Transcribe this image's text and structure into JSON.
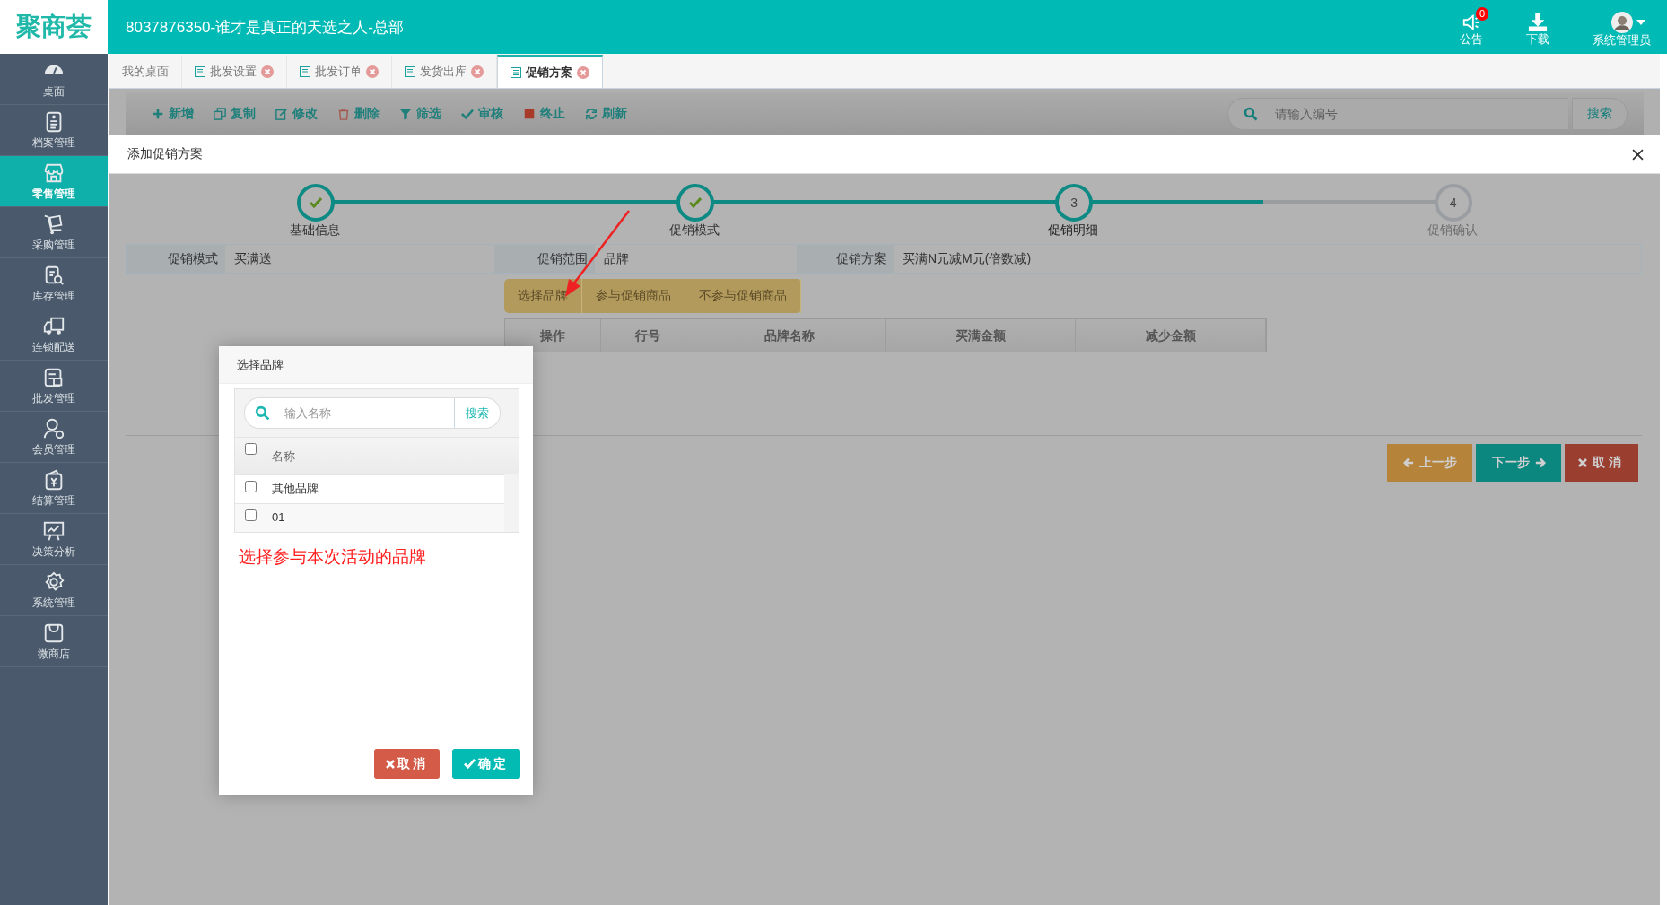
{
  "app": {
    "logo": "聚商荟",
    "title": "8037876350-谁才是真正的天选之人-总部"
  },
  "header_actions": [
    {
      "kind": "notice",
      "label": "公告",
      "badge": "0"
    },
    {
      "kind": "download",
      "label": "下载"
    },
    {
      "kind": "user",
      "label": "系统管理员"
    }
  ],
  "sidebar": [
    {
      "label": "桌面",
      "selected": false
    },
    {
      "label": "档案管理",
      "selected": false
    },
    {
      "label": "零售管理",
      "selected": true
    },
    {
      "label": "采购管理",
      "selected": false
    },
    {
      "label": "库存管理",
      "selected": false
    },
    {
      "label": "连锁配送",
      "selected": false
    },
    {
      "label": "批发管理",
      "selected": false
    },
    {
      "label": "会员管理",
      "selected": false
    },
    {
      "label": "结算管理",
      "selected": false
    },
    {
      "label": "决策分析",
      "selected": false
    },
    {
      "label": "系统管理",
      "selected": false
    },
    {
      "label": "微商店",
      "selected": false
    }
  ],
  "tabs": [
    {
      "label": "我的桌面",
      "closable": false,
      "selected": false
    },
    {
      "label": "批发设置",
      "closable": true,
      "selected": false
    },
    {
      "label": "批发订单",
      "closable": true,
      "selected": false
    },
    {
      "label": "发货出库",
      "closable": true,
      "selected": false
    },
    {
      "label": "促销方案",
      "closable": true,
      "selected": true
    }
  ],
  "toolbar": [
    "新增",
    "复制",
    "修改",
    "删除",
    "筛选",
    "审核",
    "终止",
    "刷新"
  ],
  "search": {
    "placeholder": "请输入编号",
    "button": "搜索"
  },
  "modal": {
    "title": "添加促销方案",
    "steps": [
      {
        "label": "基础信息",
        "done": true,
        "current": false
      },
      {
        "label": "促销模式",
        "done": true,
        "current": false
      },
      {
        "label": "促销明细",
        "number": "3",
        "done": false,
        "current": true
      },
      {
        "label": "促销确认",
        "number": "4",
        "done": false,
        "current": false
      }
    ],
    "info": [
      {
        "label": "促销模式",
        "value": "买满送"
      },
      {
        "label": "促销范围",
        "value": "品牌"
      },
      {
        "label": "促销方案",
        "value": "买满N元减M元(倍数减)"
      }
    ],
    "subtabs": [
      "选择品牌",
      "参与促销商品",
      "不参与促销商品"
    ],
    "columns": [
      "操作",
      "行号",
      "品牌名称",
      "买满金额",
      "减少金额"
    ],
    "buttons": [
      {
        "kind": "prev",
        "label": "上一步"
      },
      {
        "kind": "next",
        "label": "下一步"
      },
      {
        "kind": "cancel",
        "label": "取消"
      }
    ]
  },
  "brand_dialog": {
    "title": "选择品牌",
    "search": {
      "placeholder": "输入名称",
      "button": "搜索"
    },
    "header": {
      "label": "名称",
      "checked": false
    },
    "rows": [
      {
        "name": "其他品牌",
        "checked": false
      },
      {
        "name": "01",
        "checked": false
      }
    ],
    "note": "选择参与本次活动的品牌",
    "buttons": [
      {
        "kind": "cancel",
        "label": "取消"
      },
      {
        "kind": "ok",
        "label": "确定"
      }
    ]
  }
}
